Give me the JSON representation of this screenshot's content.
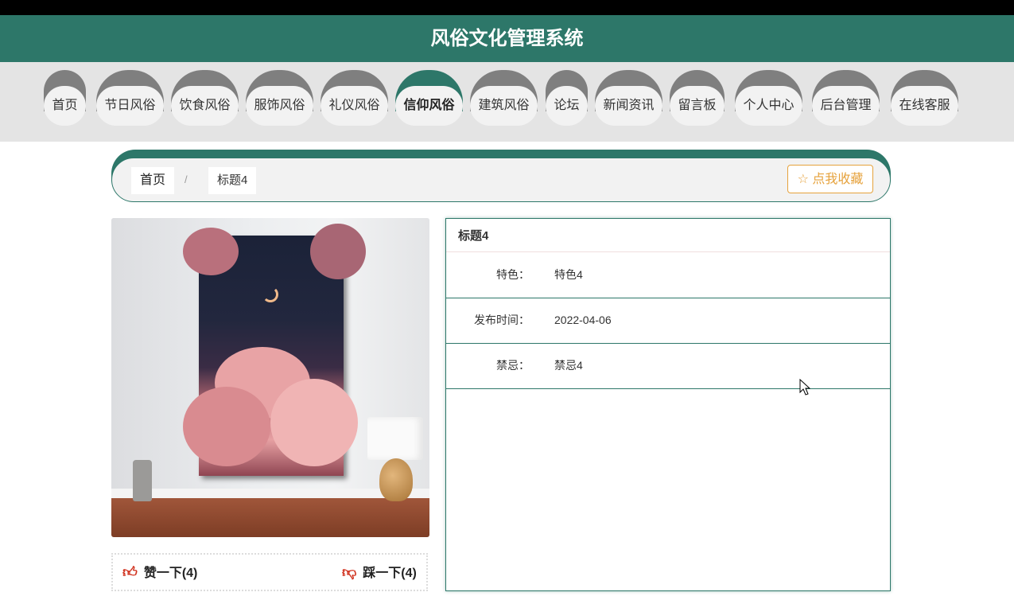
{
  "header": {
    "title": "风俗文化管理系统"
  },
  "nav": {
    "items": [
      {
        "label": "首页"
      },
      {
        "label": "节日风俗"
      },
      {
        "label": "饮食风俗"
      },
      {
        "label": "服饰风俗"
      },
      {
        "label": "礼仪风俗"
      },
      {
        "label": "信仰风俗",
        "active": true
      },
      {
        "label": "建筑风俗"
      },
      {
        "label": "论坛"
      },
      {
        "label": "新闻资讯"
      },
      {
        "label": "留言板"
      },
      {
        "label": "个人中心"
      },
      {
        "label": "后台管理"
      },
      {
        "label": "在线客服"
      }
    ]
  },
  "breadcrumb": {
    "home": "首页",
    "separator": "/",
    "current": "标题4"
  },
  "favorite": {
    "icon": "star-outline-icon",
    "label": "☆ 点我收藏"
  },
  "votes": {
    "like": {
      "icon": "thumbs-up-icon",
      "label": "赞一下(4)"
    },
    "dislike": {
      "icon": "thumbs-down-icon",
      "label": "踩一下(4)"
    }
  },
  "detail": {
    "title": "标题4",
    "rows": [
      {
        "label": "特色：",
        "value": "特色4"
      },
      {
        "label": "发布时间：",
        "value": "2022-04-06"
      },
      {
        "label": "禁忌：",
        "value": "禁忌4"
      }
    ]
  },
  "colors": {
    "primary": "#2d7769",
    "nav_cap": "#7f7f7f",
    "accent": "#e6a23c",
    "vote_icon": "#d0301c"
  }
}
